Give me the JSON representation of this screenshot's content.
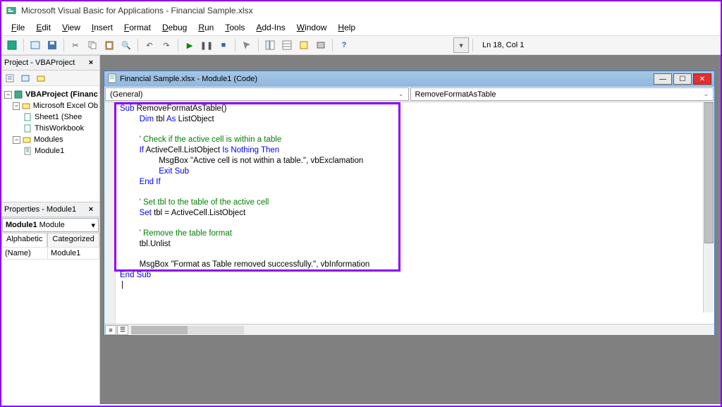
{
  "title": "Microsoft Visual Basic for Applications - Financial Sample.xlsx",
  "menus": [
    "File",
    "Edit",
    "View",
    "Insert",
    "Format",
    "Debug",
    "Run",
    "Tools",
    "Add-Ins",
    "Window",
    "Help"
  ],
  "toolbar_status": "Ln 18, Col 1",
  "project_panel": {
    "title": "Project - VBAProject",
    "tree": {
      "root_label": "VBAProject (Financ",
      "folder1_label": "Microsoft Excel Ob",
      "item1_label": "Sheet1 (Shee",
      "item2_label": "ThisWorkbook",
      "folder2_label": "Modules",
      "item3_label": "Module1"
    }
  },
  "properties_panel": {
    "title": "Properties - Module1",
    "dropdown_value": "Module1 Module",
    "tab_alpha": "Alphabetic",
    "tab_cat": "Categorized",
    "row_name": "(Name)",
    "row_value": "Module1"
  },
  "code_window": {
    "title": "Financial Sample.xlsx - Module1 (Code)",
    "dd_left": "(General)",
    "dd_right": "RemoveFormatAsTable",
    "code_lines": [
      {
        "indent": 0,
        "spans": [
          {
            "c": "k-blue",
            "t": "Sub "
          },
          {
            "c": "k-black",
            "t": "RemoveFormatAsTable()"
          }
        ]
      },
      {
        "indent": 1,
        "spans": [
          {
            "c": "k-blue",
            "t": "Dim "
          },
          {
            "c": "k-black",
            "t": "tbl "
          },
          {
            "c": "k-blue",
            "t": "As "
          },
          {
            "c": "k-black",
            "t": "ListObject"
          }
        ]
      },
      {
        "indent": 0,
        "spans": []
      },
      {
        "indent": 1,
        "spans": [
          {
            "c": "k-green",
            "t": "' Check if the active cell is within a table"
          }
        ]
      },
      {
        "indent": 1,
        "spans": [
          {
            "c": "k-blue",
            "t": "If "
          },
          {
            "c": "k-black",
            "t": "ActiveCell.ListObject "
          },
          {
            "c": "k-blue",
            "t": "Is Nothing Then"
          }
        ]
      },
      {
        "indent": 2,
        "spans": [
          {
            "c": "k-black",
            "t": "MsgBox \"Active cell is not within a table.\", vbExclamation"
          }
        ]
      },
      {
        "indent": 2,
        "spans": [
          {
            "c": "k-blue",
            "t": "Exit Sub"
          }
        ]
      },
      {
        "indent": 1,
        "spans": [
          {
            "c": "k-blue",
            "t": "End If"
          }
        ]
      },
      {
        "indent": 0,
        "spans": []
      },
      {
        "indent": 1,
        "spans": [
          {
            "c": "k-green",
            "t": "' Set tbl to the table of the active cell"
          }
        ]
      },
      {
        "indent": 1,
        "spans": [
          {
            "c": "k-blue",
            "t": "Set "
          },
          {
            "c": "k-black",
            "t": "tbl = ActiveCell.ListObject"
          }
        ]
      },
      {
        "indent": 0,
        "spans": []
      },
      {
        "indent": 1,
        "spans": [
          {
            "c": "k-green",
            "t": "' Remove the table format"
          }
        ]
      },
      {
        "indent": 1,
        "spans": [
          {
            "c": "k-black",
            "t": "tbl.Unlist"
          }
        ]
      },
      {
        "indent": 0,
        "spans": []
      },
      {
        "indent": 1,
        "spans": [
          {
            "c": "k-black",
            "t": "MsgBox \"Format as Table removed successfully.\", vbInformation"
          }
        ]
      },
      {
        "indent": 0,
        "spans": [
          {
            "c": "k-blue",
            "t": "End Sub"
          }
        ]
      }
    ]
  }
}
